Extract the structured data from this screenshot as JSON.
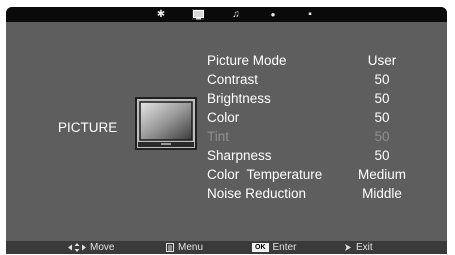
{
  "tabs": [
    {
      "name": "sun-icon",
      "glyph": "✱"
    },
    {
      "name": "monitor-icon",
      "glyph": "▀"
    },
    {
      "name": "music-note-icon",
      "glyph": "♫"
    },
    {
      "name": "clock-icon",
      "glyph": "●"
    },
    {
      "name": "grid-icon",
      "glyph": "▪"
    }
  ],
  "section_title": "PICTURE",
  "menu": {
    "picture_mode": {
      "label": "Picture Mode",
      "value": "User"
    },
    "contrast": {
      "label": "Contrast",
      "value": "50"
    },
    "brightness": {
      "label": "Brightness",
      "value": "50"
    },
    "color": {
      "label": "Color",
      "value": "50"
    },
    "tint": {
      "label": "Tint",
      "value": "50"
    },
    "sharpness": {
      "label": "Sharpness",
      "value": "50"
    },
    "color_temperature": {
      "label": "Color  Temperature",
      "value": "Medium"
    },
    "noise_reduction": {
      "label": "Noise Reduction",
      "value": "Middle"
    }
  },
  "footer": {
    "move": "Move",
    "menu": "Menu",
    "ok_key": "OK",
    "enter": "Enter",
    "exit": "Exit"
  },
  "colors": {
    "panel": "#5e5e5e",
    "topbar": "#0a0a0a",
    "footer": "#3a3a3a",
    "text": "#ffffff",
    "disabled_text": "#8f8f8f"
  }
}
